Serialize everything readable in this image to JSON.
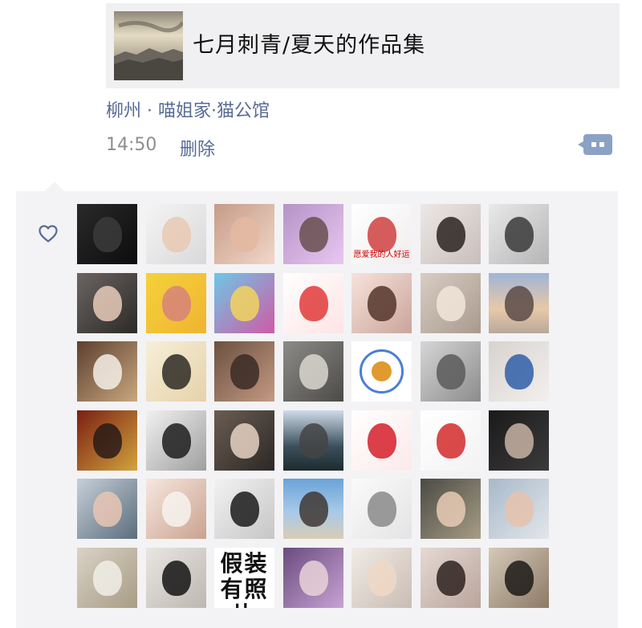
{
  "post": {
    "link_title": "七月刺青/夏天的作品集",
    "location": "柳州 · 喵姐家·猫公馆",
    "time": "14:50",
    "delete_label": "删除"
  },
  "icons": {
    "comment": "comment-icon",
    "like": "heart-icon"
  },
  "colors": {
    "link_blue": "#576b95",
    "panel_bg": "#f3f3f5",
    "card_bg": "#f0f0f2",
    "comment_button": "#8ba2c5"
  },
  "likes": {
    "avatars": [
      {
        "bg": "linear-gradient(135deg,#2a2a2a,#0c0c0c)",
        "center": "#3b3b3b"
      },
      {
        "bg": "linear-gradient(135deg,#f4f4f4,#d9d9d9)",
        "center": "#e8c9b3"
      },
      {
        "bg": "linear-gradient(135deg,#c79b88,#f1d7c8)",
        "center": "#e4b8a1"
      },
      {
        "bg": "linear-gradient(135deg,#b693c7,#e9c7f0)",
        "center": "#6a4f4f"
      },
      {
        "bg": "linear-gradient(135deg,#ffffff,#f1eded)",
        "center": "#d04040",
        "badge": "愿爱我的人好运"
      },
      {
        "bg": "linear-gradient(135deg,#ece8e6,#c9bebb)",
        "center": "#2b2320"
      },
      {
        "bg": "linear-gradient(135deg,#e9e9e9,#b5b5b5)",
        "center": "#3a3a3a"
      },
      {
        "bg": "linear-gradient(135deg,#6b6462,#2c2a28)",
        "center": "#e8cbb8"
      },
      {
        "bg": "linear-gradient(135deg,#f4d23a,#f0b431)",
        "center": "#d7837a"
      },
      {
        "bg": "linear-gradient(135deg,#6ec7e6,#d05aa5)",
        "center": "#f2d35e"
      },
      {
        "bg": "linear-gradient(135deg,#ffffff,#fde4e4)",
        "center": "#e23a3a"
      },
      {
        "bg": "linear-gradient(135deg,#f6e3dc,#caa59a)",
        "center": "#53352c"
      },
      {
        "bg": "linear-gradient(135deg,#d8cdc4,#a99a8d)",
        "center": "#f2e6dc"
      },
      {
        "bg": "linear-gradient(180deg,#9fb4d6,#e8c9a8 60%,#b8a89a)",
        "center": "#5a4a48"
      },
      {
        "bg": "linear-gradient(135deg,#5c4030,#c9a77d)",
        "center": "#f5efe6"
      },
      {
        "bg": "linear-gradient(135deg,#f6efd9,#e6d2a8)",
        "center": "#2e2a24"
      },
      {
        "bg": "linear-gradient(135deg,#6b5040,#c49a83)",
        "center": "#3a2c26"
      },
      {
        "bg": "linear-gradient(135deg,#8d8b87,#4d4b48)",
        "center": "#d9d6cf"
      },
      {
        "bg": "#ffffff",
        "circle": true
      },
      {
        "bg": "linear-gradient(135deg,#d6d6d6,#8c8c8c)",
        "center": "#5a5a5a"
      },
      {
        "bg": "linear-gradient(135deg,#d8d3cf,#f2efed)",
        "center": "#2f5ea8"
      },
      {
        "bg": "linear-gradient(135deg,#7a1f14,#d2a33c)",
        "center": "#2a1a18"
      },
      {
        "bg": "linear-gradient(135deg,#f1f1f1,#9f9f9f)",
        "center": "#1d1d1d"
      },
      {
        "bg": "linear-gradient(135deg,#6a5d52,#2c2826)",
        "center": "#e6d2c4"
      },
      {
        "bg": "linear-gradient(180deg,#cfdbe8,#3c4f5c 60%,#1e2b2e)",
        "center": "#444"
      },
      {
        "bg": "linear-gradient(135deg,#ffffff,#fbe9e9)",
        "center": "#d51f2a"
      },
      {
        "bg": "linear-gradient(135deg,#ffffff,#f3f3f3)",
        "center": "#d42a2a"
      },
      {
        "bg": "linear-gradient(135deg,#1a1a1a,#3b3b3b)",
        "center": "#c9b3a4"
      },
      {
        "bg": "linear-gradient(135deg,#c6cfd9,#5b6d7c)",
        "center": "#e8c5b4"
      },
      {
        "bg": "linear-gradient(135deg,#f6e7df,#caa38f)",
        "center": "#f7f3ef"
      },
      {
        "bg": "linear-gradient(135deg,#f2f2f2,#c6c6c6)",
        "center": "#1b1b1b"
      },
      {
        "bg": "linear-gradient(180deg,#6aa3d8,#a7c9e8 55%,#d9cdb5)",
        "center": "#403734"
      },
      {
        "bg": "linear-gradient(135deg,#fafafa,#e4e4e4)",
        "center": "#8a8a8a"
      },
      {
        "bg": "linear-gradient(135deg,#4b4a43,#a69d86)",
        "center": "#e8cbb5"
      },
      {
        "bg": "linear-gradient(135deg,#a8b9c9,#e3e6ea)",
        "center": "#e6c2ad"
      },
      {
        "bg": "linear-gradient(135deg,#d9d2c4,#a89c86)",
        "center": "#f1efe8"
      },
      {
        "bg": "linear-gradient(135deg,#e9e6e2,#bdb7b0)",
        "center": "#141414"
      },
      {
        "bg": "#ffffff",
        "text": "假装有照片"
      },
      {
        "bg": "linear-gradient(135deg,#6a4b7e,#c7a3d4)",
        "center": "#e9d2d8"
      },
      {
        "bg": "linear-gradient(135deg,#f1ebe6,#c9bdb3)",
        "center": "#efd8c7"
      },
      {
        "bg": "linear-gradient(135deg,#e5d9d3,#b9a59c)",
        "center": "#2e2220"
      },
      {
        "bg": "linear-gradient(135deg,#d5c9b8,#8c7a66)",
        "center": "#1c1a16"
      }
    ]
  }
}
